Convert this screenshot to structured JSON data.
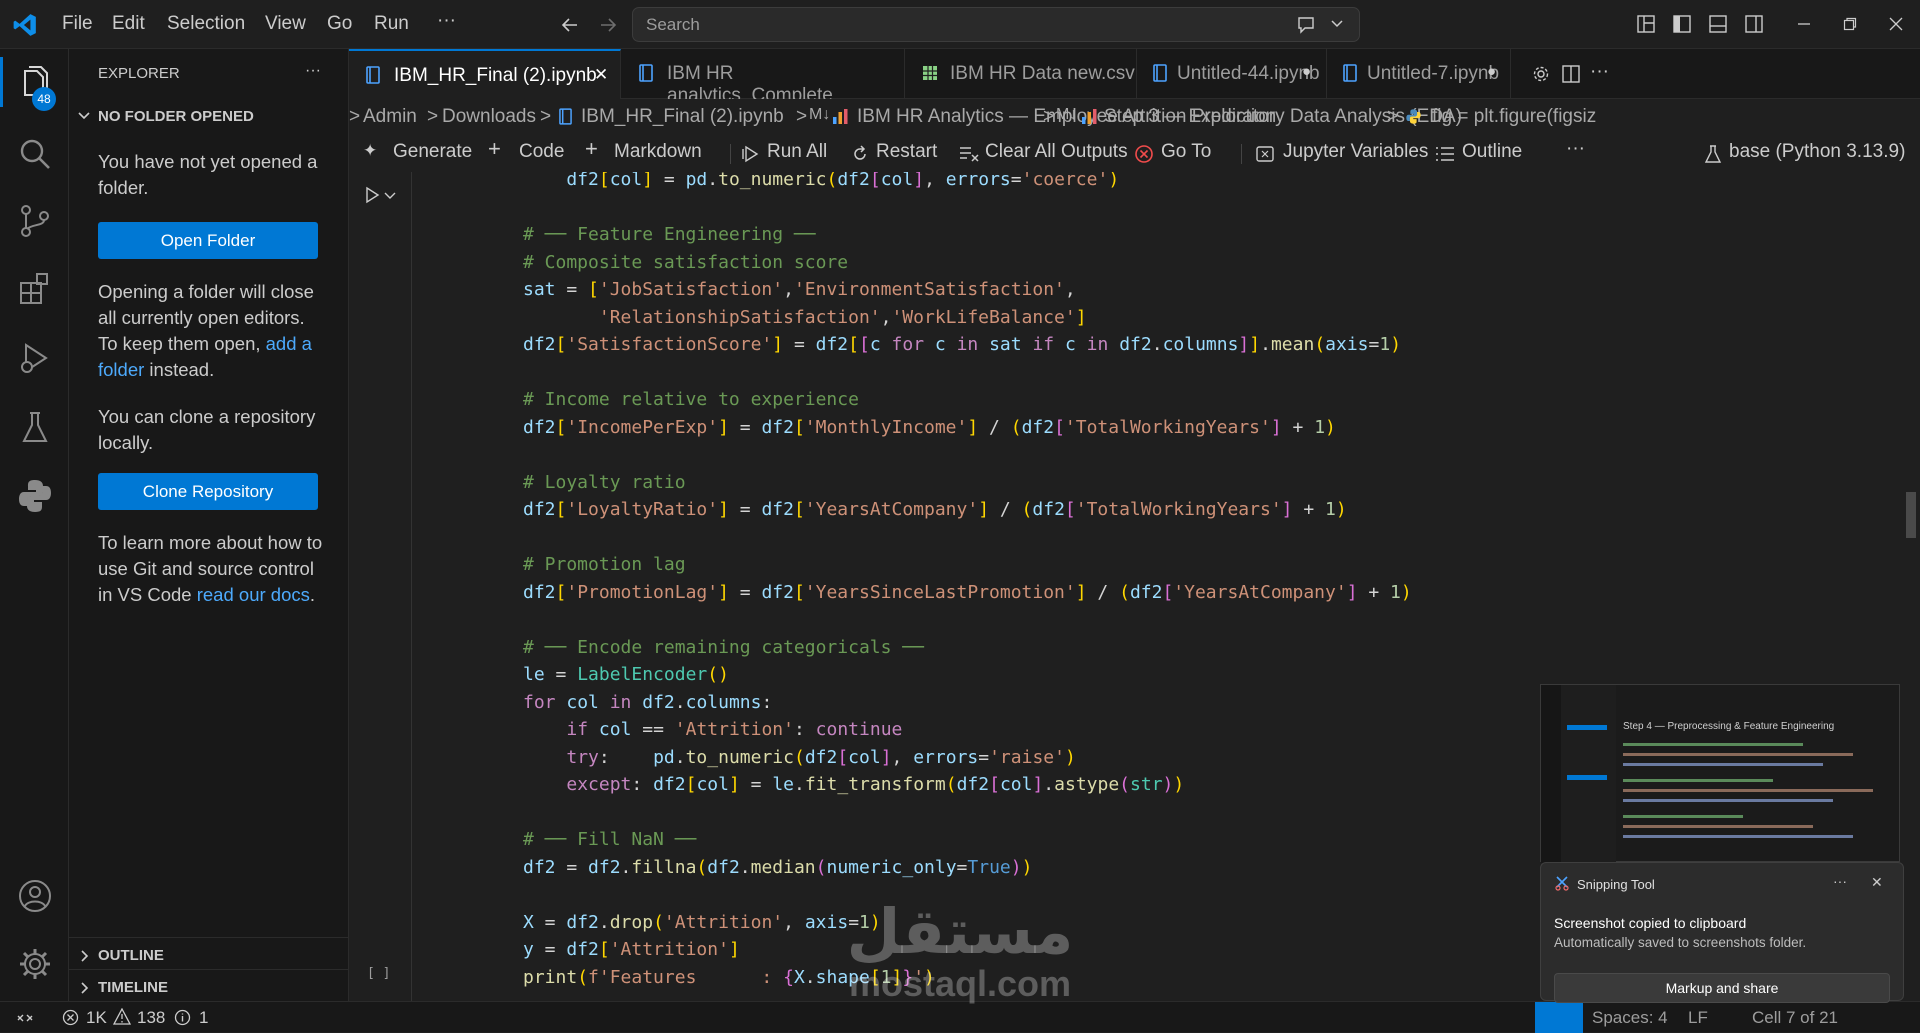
{
  "menu": [
    "File",
    "Edit",
    "Selection",
    "View",
    "Go",
    "Run",
    "···"
  ],
  "search": {
    "placeholder": "Search"
  },
  "activity": {
    "explorer_badge": "48"
  },
  "sidebar": {
    "title": "EXPLORER",
    "more": "···",
    "section": "NO FOLDER OPENED",
    "msg1": "You have not yet opened a folder.",
    "open_folder": "Open Folder",
    "msg2_a": "Opening a folder will close all currently open editors. To keep them open,",
    "msg2_link": "add a folder",
    "msg2_b": "instead.",
    "msg3": "You can clone a repository locally.",
    "clone": "Clone Repository",
    "msg4_a": "To learn more about how to use Git and source control in VS Code",
    "msg4_link": "read our docs",
    "msg4_b": ".",
    "outline": "OUTLINE",
    "timeline": "TIMELINE"
  },
  "tabs": [
    {
      "label": "IBM_HR_Final (2).ipynb",
      "active": true,
      "close": "✕"
    },
    {
      "label": "IBM HR analytics_Complete Model_.ipynb"
    },
    {
      "label": "IBM HR Data new.csv"
    },
    {
      "label": "Untitled-44.ipynb",
      "dirty": "●"
    },
    {
      "label": "Untitled-7.ipynb",
      "dirty": "●"
    }
  ],
  "breadcrumb": {
    "items": [
      "Admin",
      "Downloads",
      "IBM_HR_Final (2).ipynb",
      "IBM HR Analytics — Employee Attrition Prediction",
      "Step 3 — Exploratory Data Analysis (EDA)",
      "fig = plt.figure(figsiz"
    ],
    "sep": ">",
    "md": "M↓"
  },
  "toolbar": {
    "generate": "Generate",
    "code": "Code",
    "markdown": "Markdown",
    "run_all": "Run All",
    "restart": "Restart",
    "clear": "Clear All Outputs",
    "goto": "Go To",
    "variables": "Jupyter Variables",
    "outline": "Outline",
    "more": "···",
    "kernel": "base (Python 3.13.9)"
  },
  "cell": {
    "exec_count": "[ ]"
  },
  "status": {
    "errors": "1K",
    "warnings": "138",
    "info": "1",
    "spaces": "Spaces: 4",
    "eol": "LF",
    "cell": "Cell 7 of 21"
  },
  "snip": {
    "preview_title": "Step 4 — Preprocessing & Feature Engineering",
    "app": "Snipping Tool",
    "more": "···",
    "close": "✕",
    "title": "Screenshot copied to clipboard",
    "subtitle": "Automatically saved to screenshots folder.",
    "button": "Markup and share"
  },
  "watermark": {
    "arabic": "مستقل",
    "latin": "mostaql.com"
  },
  "colors": {
    "accent": "#0078d4",
    "link": "#4daafc",
    "badge": "#0078d4"
  }
}
